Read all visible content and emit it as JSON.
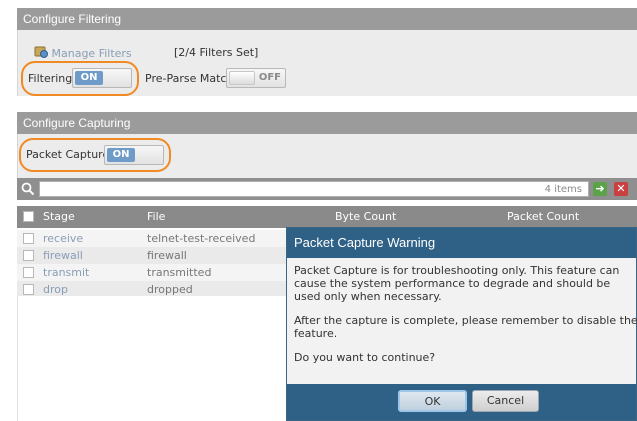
{
  "filtering": {
    "header": "Configure Filtering",
    "manage_filters": "Manage Filters",
    "filters_set": "[2/4 Filters Set]",
    "filtering_label": "Filtering",
    "filtering_state": "ON",
    "preparse_label": "Pre-Parse Match",
    "preparse_state": "OFF"
  },
  "capturing": {
    "header": "Configure Capturing",
    "packet_capture_label": "Packet Capture",
    "packet_capture_state": "ON"
  },
  "table": {
    "search_value": "",
    "items_count": "4 items",
    "columns": [
      "Stage",
      "File",
      "Byte Count",
      "Packet Count"
    ],
    "rows": [
      {
        "stage": "receive",
        "file": "telnet-test-received"
      },
      {
        "stage": "firewall",
        "file": "firewall"
      },
      {
        "stage": "transmit",
        "file": "transmitted"
      },
      {
        "stage": "drop",
        "file": "dropped"
      }
    ]
  },
  "dialog": {
    "title": "Packet Capture Warning",
    "message_1": "Packet Capture is for troubleshooting only. This feature can cause the system performance to degrade and should be used only when necessary.",
    "message_2": "After the capture is complete, please remember to disable the feature.",
    "message_3": "Do you want to continue?",
    "ok_label": "OK",
    "cancel_label": "Cancel"
  },
  "colors": {
    "accent": "#2f6187",
    "toggle_on": "#6f9bc9",
    "highlight": "#f08a24"
  },
  "icons": {
    "manage_filters": "filter-icon",
    "search": "search-icon",
    "add": "add-icon",
    "clear": "clear-icon"
  }
}
